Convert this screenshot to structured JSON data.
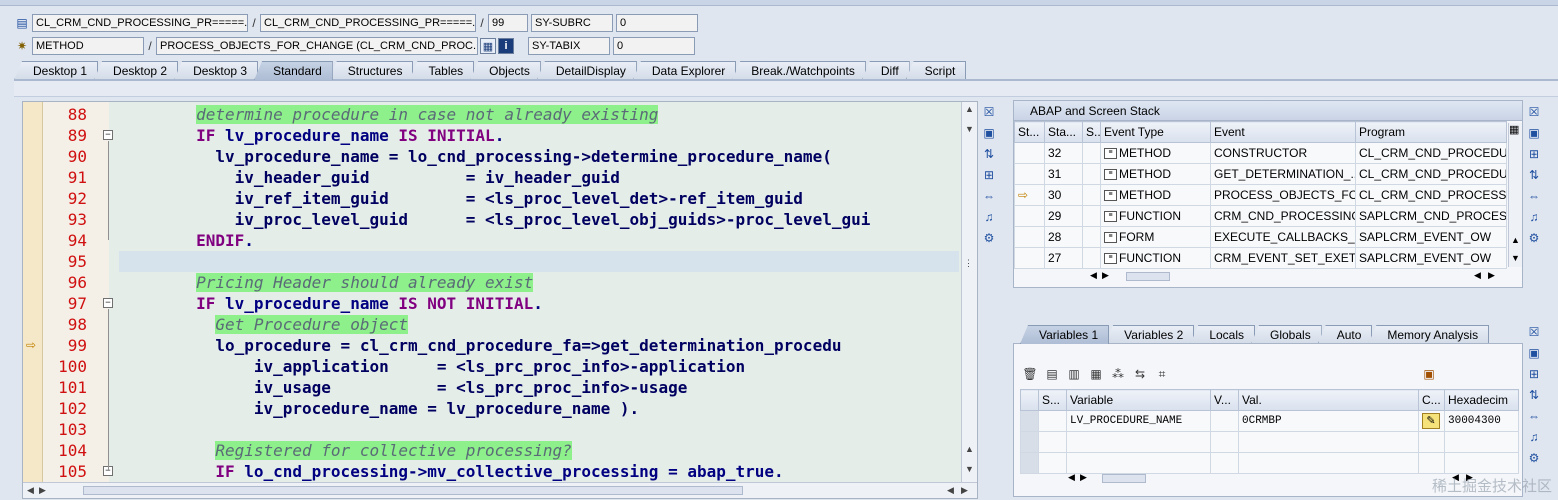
{
  "info": {
    "row1": {
      "program": "CL_CRM_CND_PROCESSING_PR=====...",
      "include": "CL_CRM_CND_PROCESSING_PR=====...",
      "line": "99",
      "var_name": "SY-SUBRC",
      "var_value": "0"
    },
    "row2": {
      "type": "METHOD",
      "name": "PROCESS_OBJECTS_FOR_CHANGE (CL_CRM_CND_PROC...",
      "var_name": "SY-TABIX",
      "var_value": "0"
    }
  },
  "tabs": [
    "Desktop 1",
    "Desktop 2",
    "Desktop 3",
    "Standard",
    "Structures",
    "Tables",
    "Objects",
    "DetailDisplay",
    "Data Explorer",
    "Break./Watchpoints",
    "Diff",
    "Script"
  ],
  "active_tab": "Standard",
  "code": {
    "lines": [
      {
        "n": "88",
        "text": "        determine procedure in case not already existing",
        "type": "comment"
      },
      {
        "n": "89",
        "pre": "        ",
        "kw1": "IF",
        "mid": " lv_procedure_name ",
        "kw2": "IS INITIAL",
        "post": ".",
        "type": "if"
      },
      {
        "n": "90",
        "text": "          lv_procedure_name = lo_cnd_processing->determine_procedure_name(",
        "type": "bold"
      },
      {
        "n": "91",
        "text": "            iv_header_guid          = iv_header_guid",
        "type": "bold"
      },
      {
        "n": "92",
        "text": "            iv_ref_item_guid        = <ls_proc_level_det>-ref_item_guid",
        "type": "bold"
      },
      {
        "n": "93",
        "text": "            iv_proc_level_guid      = <ls_proc_level_obj_guids>-proc_level_gui",
        "type": "bold"
      },
      {
        "n": "94",
        "pre": "        ",
        "kw1": "ENDIF",
        "mid": "",
        "kw2": "",
        "post": ".",
        "type": "if"
      },
      {
        "n": "95",
        "text": "",
        "type": "blank"
      },
      {
        "n": "96",
        "text": "        Pricing Header should already exist",
        "type": "comment"
      },
      {
        "n": "97",
        "pre": "        ",
        "kw1": "IF",
        "mid": " lv_procedure_name ",
        "kw2": "IS NOT INITIAL",
        "post": ".",
        "type": "if"
      },
      {
        "n": "98",
        "text": "          Get Procedure object",
        "type": "comment"
      },
      {
        "n": "99",
        "text": "          lo_procedure = cl_crm_cnd_procedure_fa=>get_determination_procedu",
        "type": "bold"
      },
      {
        "n": "100",
        "text": "              iv_application     = <ls_prc_proc_info>-application",
        "type": "bold"
      },
      {
        "n": "101",
        "text": "              iv_usage           = <ls_prc_proc_info>-usage",
        "type": "bold"
      },
      {
        "n": "102",
        "text": "              iv_procedure_name = lv_procedure_name ).",
        "type": "bold"
      },
      {
        "n": "103",
        "text": "",
        "type": "blank"
      },
      {
        "n": "104",
        "text": "          Registered for collective processing?",
        "type": "comment"
      },
      {
        "n": "105",
        "pre": "          ",
        "kw1": "IF",
        "mid": " lo_cnd_processing->mv_collective_processing = abap_true",
        "kw2": "",
        "post": ".",
        "type": "if"
      }
    ]
  },
  "stack": {
    "title": "ABAP and Screen Stack",
    "columns": [
      "St...",
      "Sta...",
      "S...",
      "Event Type",
      "Event",
      "Program"
    ],
    "rows": [
      {
        "level": "32",
        "type": "METHOD",
        "event": "CONSTRUCTOR",
        "program": "CL_CRM_CND_PROCEDU..."
      },
      {
        "level": "31",
        "type": "METHOD",
        "event": "GET_DETERMINATION_...",
        "program": "CL_CRM_CND_PROCEDU..."
      },
      {
        "level": "30",
        "type": "METHOD",
        "event": "PROCESS_OBJECTS_FOR...",
        "program": "CL_CRM_CND_PROCESSI..."
      },
      {
        "level": "29",
        "type": "FUNCTION",
        "event": "CRM_CND_PROCESSING_...",
        "program": "SAPLCRM_CND_PROCES..."
      },
      {
        "level": "28",
        "type": "FORM",
        "event": "EXECUTE_CALLBACKS_P...",
        "program": "SAPLCRM_EVENT_OW"
      },
      {
        "level": "27",
        "type": "FUNCTION",
        "event": "CRM_EVENT_SET_EXETI...",
        "program": "SAPLCRM_EVENT_OW"
      }
    ]
  },
  "var_tabs": [
    "Variables 1",
    "Variables 2",
    "Locals",
    "Globals",
    "Auto",
    "Memory Analysis"
  ],
  "variables": {
    "columns": [
      "S...",
      "Variable",
      "V...",
      "Val.",
      "C...",
      "Hexadecim"
    ],
    "rows": [
      {
        "variable": "LV_PROCEDURE_NAME",
        "value": "0CRMBP",
        "hex": "30004300"
      }
    ]
  },
  "watermark": "稀土掘金技术社区"
}
